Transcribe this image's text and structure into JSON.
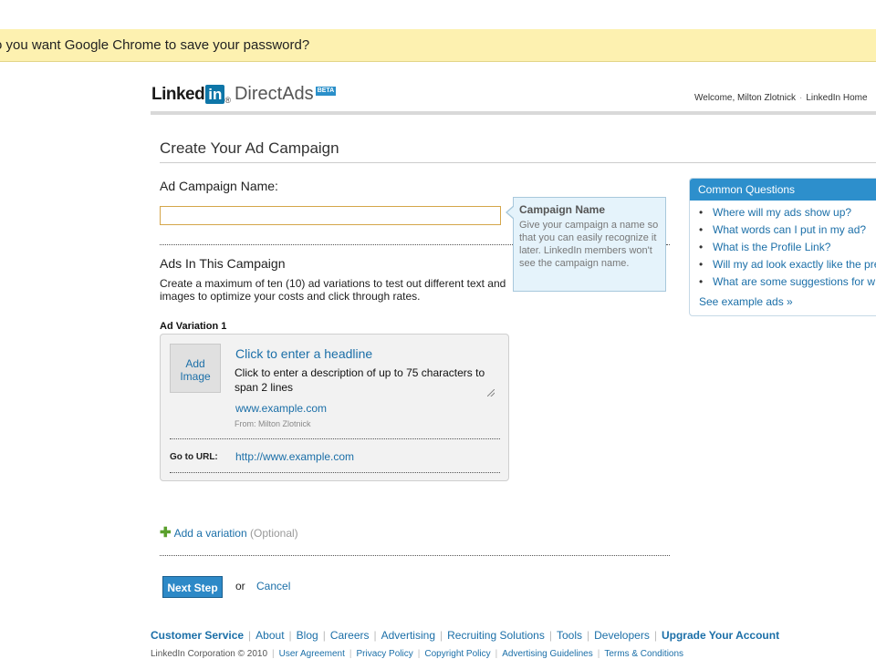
{
  "browser": {
    "infobar_text": "o you want Google Chrome to save your password?"
  },
  "header": {
    "logo_linked": "Linked",
    "logo_in": "in",
    "logo_reg": "®",
    "logo_product": "DirectAds",
    "logo_badge": "BETA",
    "welcome": "Welcome, Milton Zlotnick",
    "home_link": "LinkedIn Home"
  },
  "main": {
    "title": "Create Your Ad Campaign",
    "campaign_name_label": "Ad Campaign Name:",
    "campaign_name_value": "",
    "tooltip": {
      "title": "Campaign Name",
      "body": "Give your campaign a name so that you can easily recognize it later. LinkedIn members won't see the campaign name."
    },
    "ads_section_title": "Ads In This Campaign",
    "ads_section_desc": "Create a maximum of ten (10) ad variations to test out different text and images to optimize your costs and click through rates.",
    "variation": {
      "label": "Ad Variation 1",
      "add_image": "Add Image",
      "headline": "Click to enter a headline",
      "description": "Click to enter a description of up to 75 characters to span 2 lines",
      "display_url": "www.example.com",
      "from": "From: Milton Zlotnick",
      "goto_label": "Go to URL:",
      "goto_url": "http://www.example.com"
    },
    "add_variation_link": "Add a variation",
    "add_variation_optional": "(Optional)",
    "next_button": "Next Step",
    "or_text": "or",
    "cancel_link": "Cancel"
  },
  "sidebar": {
    "title": "Common Questions",
    "questions": [
      "Where will my ads show up?",
      "What words can I put in my ad?",
      "What is the Profile Link?",
      "Will my ad look exactly like the pre",
      "What are some suggestions for w"
    ],
    "see_examples": "See example ads »"
  },
  "footer": {
    "nav": [
      "Customer Service",
      "About",
      "Blog",
      "Careers",
      "Advertising",
      "Recruiting Solutions",
      "Tools",
      "Developers",
      "Upgrade Your Account"
    ],
    "copyright": "LinkedIn Corporation © 2010",
    "legal": [
      "User Agreement",
      "Privacy Policy",
      "Copyright Policy",
      "Advertising Guidelines",
      "Terms & Conditions"
    ]
  },
  "colors": {
    "link": "#1b6fa8",
    "accent": "#2d89c7",
    "infobar": "#fdf1b0",
    "tooltip_bg": "#e5f3fb"
  }
}
